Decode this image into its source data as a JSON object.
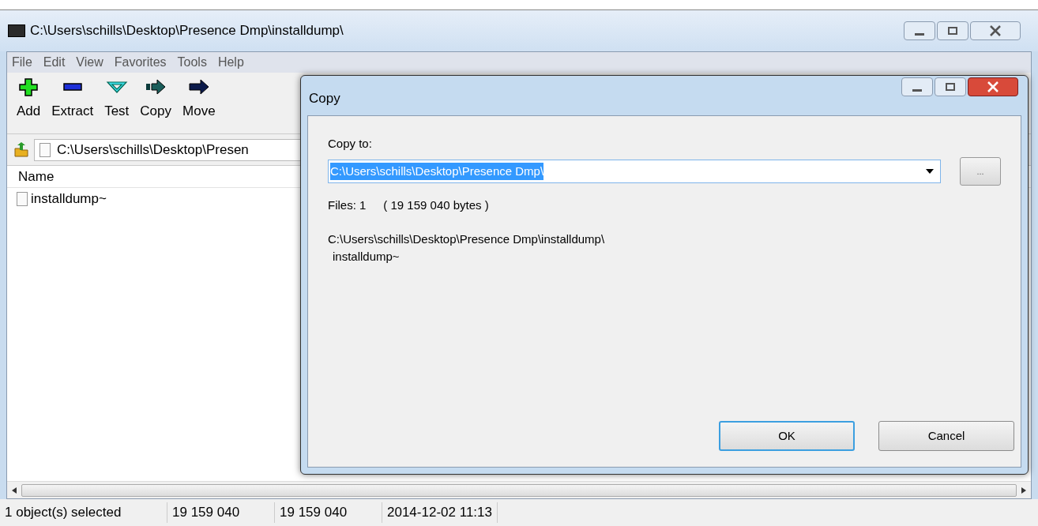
{
  "window": {
    "title": "C:\\Users\\schills\\Desktop\\Presence Dmp\\installdump\\"
  },
  "menu": [
    "File",
    "Edit",
    "View",
    "Favorites",
    "Tools",
    "Help"
  ],
  "toolbar": [
    {
      "label": "Add",
      "kind": "add"
    },
    {
      "label": "Extract",
      "kind": "extract"
    },
    {
      "label": "Test",
      "kind": "test"
    },
    {
      "label": "Copy",
      "kind": "copy"
    },
    {
      "label": "Move",
      "kind": "move"
    }
  ],
  "address": {
    "value": "C:\\Users\\schills\\Desktop\\Presen"
  },
  "list": {
    "columns": [
      "Name"
    ],
    "rows": [
      {
        "name": "installdump~"
      }
    ]
  },
  "status_bar": [
    "1 object(s) selected",
    "19 159 040",
    "19 159 040",
    "2014-12-02 11:13"
  ],
  "dialog": {
    "title": "Copy",
    "label": "Copy to:",
    "path": {
      "value": "C:\\Users\\schills\\Desktop\\Presence Dmp\\",
      "selected": true
    },
    "browse": "...",
    "files": "Files: 1",
    "bytes": "( 19 159 040 bytes )",
    "source_path": "C:\\Users\\schills\\Desktop\\Presence Dmp\\installdump\\",
    "source_file": "installdump~",
    "buttons": [
      {
        "label": "OK",
        "default": true
      },
      {
        "label": "Cancel",
        "default": false
      }
    ]
  }
}
